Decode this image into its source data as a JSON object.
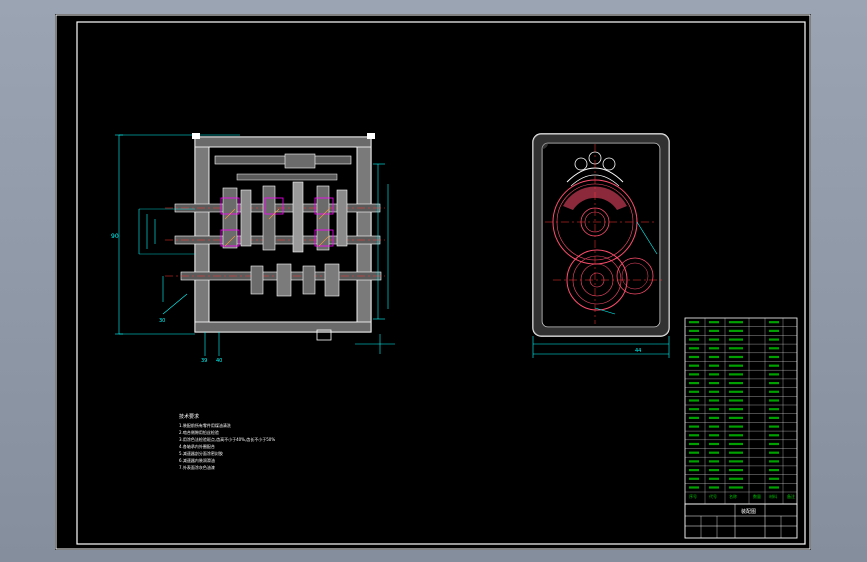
{
  "app": {
    "name": "CAD drawing viewer"
  },
  "colors": {
    "background_workspace": "#8e98a6",
    "paper": "#000000",
    "border": "#ffffff",
    "dimension": "#00ffff",
    "gear_outline": "#ff4d6d",
    "hatch": "#ff9a3c",
    "centerline": "#ff3030",
    "bom_text": "#00c800",
    "notes_text": "#ffffff",
    "housing": "#ffffff",
    "highlight_bearing": "#ff00ff"
  },
  "drawing": {
    "views": [
      {
        "name": "front-section-view"
      },
      {
        "name": "side-view"
      }
    ],
    "notes": {
      "title": "技术要求",
      "lines": [
        "1.装配前所有零件用煤油清洗",
        "2.啮合侧隙用铅丝检验",
        "3.用涂色法检验斑点,齿高不小于40%,齿长不小于50%",
        "4.各轴承内外圈配合",
        "5.减速器剖分面涂密封胶",
        "6.减速器内装润滑油",
        "7.外表面涂灰色油漆"
      ]
    },
    "bom": {
      "headers": [
        "序号",
        "代号",
        "名称",
        "数量",
        "材料",
        "备注"
      ],
      "rows": 20
    },
    "title_block": {
      "title": "装配图"
    },
    "dimension_labels": [
      "30",
      "39",
      "40",
      "90",
      "44"
    ]
  }
}
